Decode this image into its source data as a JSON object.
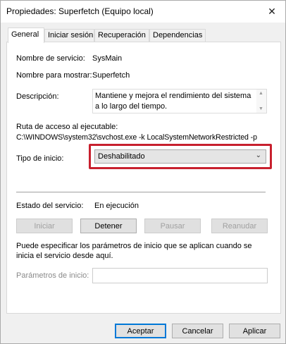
{
  "window": {
    "title": "Propiedades: Superfetch (Equipo local)"
  },
  "tabs": [
    "General",
    "Iniciar sesión",
    "Recuperación",
    "Dependencias"
  ],
  "general": {
    "service_name_label": "Nombre de servicio:",
    "service_name_value": "SysMain",
    "display_name_label": "Nombre para mostrar:",
    "display_name_value": "Superfetch",
    "description_label": "Descripción:",
    "description_value": "Mantiene y mejora el rendimiento del sistema a lo largo del tiempo.",
    "exe_path_label": "Ruta de acceso al ejecutable:",
    "exe_path_value": "C:\\WINDOWS\\system32\\svchost.exe -k LocalSystemNetworkRestricted -p",
    "startup_type_label": "Tipo de inicio:",
    "startup_type_value": "Deshabilitado",
    "service_status_label": "Estado del servicio:",
    "service_status_value": "En ejecución",
    "buttons": {
      "start": "Iniciar",
      "stop": "Detener",
      "pause": "Pausar",
      "resume": "Reanudar"
    },
    "params_hint": "Puede especificar los parámetros de inicio que se aplican cuando se inicia el servicio desde aquí.",
    "params_label": "Parámetros de inicio:",
    "params_value": ""
  },
  "footer": {
    "accept": "Aceptar",
    "cancel": "Cancelar",
    "apply": "Aplicar"
  },
  "colors": {
    "highlight_border": "#c8202e",
    "dialog_bg": "#f0f0f0"
  }
}
